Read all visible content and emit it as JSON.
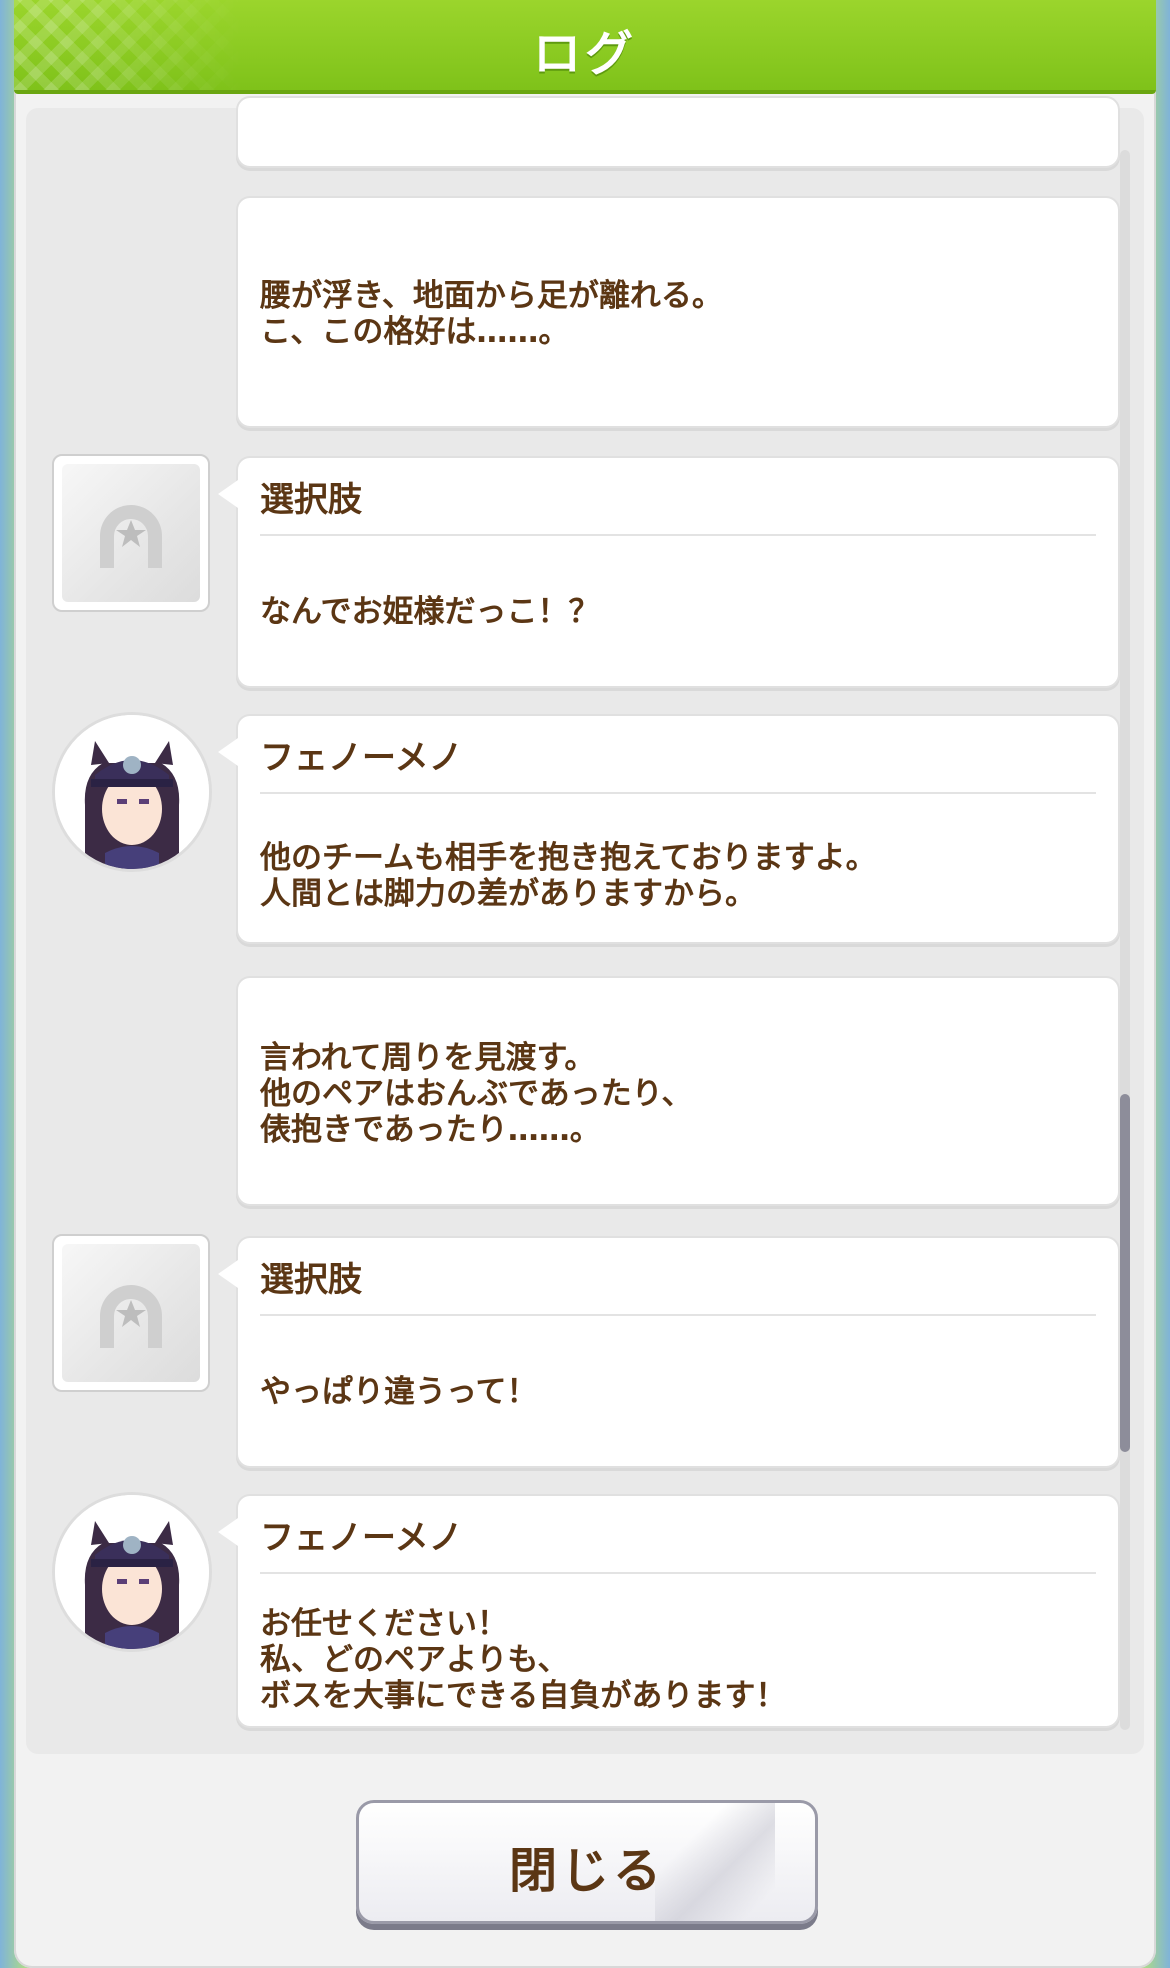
{
  "header": {
    "title": "ログ"
  },
  "entries": [
    {
      "type": "narration",
      "lines": []
    },
    {
      "type": "narration",
      "lines": [
        "腰が浮き、地面から足が離れる。",
        "こ、この格好は……。"
      ]
    },
    {
      "type": "choice",
      "speaker": "選択肢",
      "icon": "horseshoe-star-icon",
      "lines": [
        "なんでお姫様だっこ！？"
      ]
    },
    {
      "type": "dialogue",
      "speaker": "フェノーメノ",
      "icon": "character-avatar",
      "lines": [
        "他のチームも相手を抱き抱えておりますよ。",
        "人間とは脚力の差がありますから。"
      ]
    },
    {
      "type": "narration",
      "lines": [
        "言われて周りを見渡す。",
        "他のペアはおんぶであったり、",
        "俵抱きであったり……。"
      ]
    },
    {
      "type": "choice",
      "speaker": "選択肢",
      "icon": "horseshoe-star-icon",
      "lines": [
        "やっぱり違うって！"
      ]
    },
    {
      "type": "dialogue",
      "speaker": "フェノーメノ",
      "icon": "character-avatar",
      "lines": [
        "お任せください！",
        "私、どのペアよりも、",
        "ボスを大事にできる自負があります！"
      ]
    }
  ],
  "footer": {
    "close_label": "閉じる"
  },
  "colors": {
    "header": "#8ccc22",
    "text": "#5b3614"
  }
}
